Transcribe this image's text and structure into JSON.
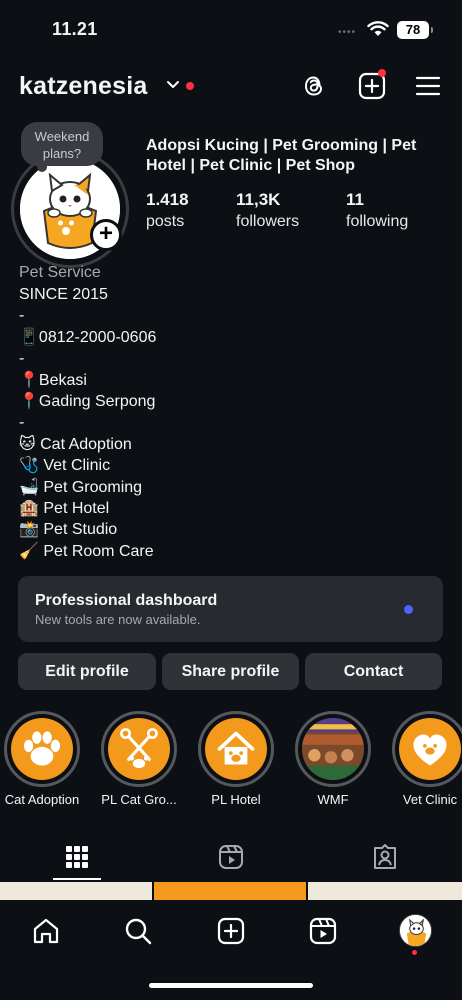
{
  "status_bar": {
    "time": "11.21",
    "battery": "78",
    "dots": "••••"
  },
  "header": {
    "username": "katzenesia",
    "icons": [
      "chevron-down-icon",
      "threads-icon",
      "create-icon",
      "menu-icon"
    ]
  },
  "profile": {
    "note": "Weekend plans?",
    "display_title": "Adopsi Kucing | Pet Grooming | Pet Hotel | Pet Clinic | Pet Shop",
    "stats": [
      {
        "value": "1.418",
        "label": "posts"
      },
      {
        "value": "11,3K",
        "label": "followers"
      },
      {
        "value": "11",
        "label": "following"
      }
    ],
    "category": "Pet Service",
    "bio": [
      "SINCE 2015",
      "-",
      "📱0812-2000-0606",
      "-",
      "📍Bekasi",
      "📍Gading Serpong",
      "-",
      "🐱 Cat Adoption",
      "🩺 Vet Clinic",
      "🛁 Pet Grooming",
      "🏨 Pet Hotel",
      "📸 Pet Studio",
      "🧹 Pet Room Care"
    ]
  },
  "dashboard": {
    "title": "Professional dashboard",
    "subtitle": "New tools are now available."
  },
  "buttons": {
    "edit": "Edit profile",
    "share": "Share profile",
    "contact": "Contact"
  },
  "highlights": [
    {
      "label": "Cat Adoption",
      "icon": "paw-icon"
    },
    {
      "label": "PL Cat Gro...",
      "icon": "grooming-icon"
    },
    {
      "label": "PL Hotel",
      "icon": "house-paw-icon"
    },
    {
      "label": "WMF",
      "icon": "photo-collage"
    },
    {
      "label": "Vet Clinic",
      "icon": "heart-paw-icon"
    }
  ],
  "tabs": [
    "grid-icon",
    "reels-icon",
    "tagged-icon"
  ],
  "bottom_nav": [
    "home-icon",
    "search-icon",
    "create-icon",
    "reels-icon",
    "profile-avatar"
  ],
  "colors": {
    "background": "#0c0f14",
    "accent_orange": "#f39a1c",
    "notification_red": "#ff3040",
    "dashboard_dot": "#4d63ff",
    "button_bg": "#2f3237"
  }
}
